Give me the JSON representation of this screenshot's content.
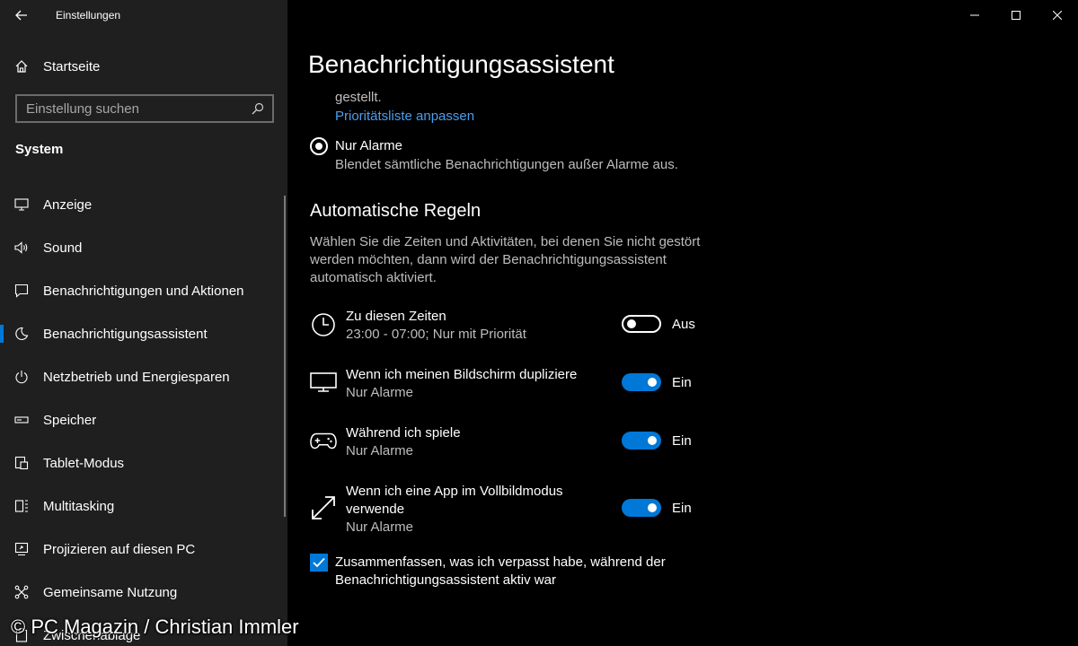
{
  "window": {
    "app_title": "Einstellungen"
  },
  "sidebar": {
    "home_label": "Startseite",
    "search_placeholder": "Einstellung suchen",
    "section_label": "System",
    "items": [
      {
        "label": "Anzeige",
        "icon": "monitor-icon"
      },
      {
        "label": "Sound",
        "icon": "speaker-icon"
      },
      {
        "label": "Benachrichtigungen und Aktionen",
        "icon": "message-icon"
      },
      {
        "label": "Benachrichtigungsassistent",
        "icon": "moon-icon",
        "active": true
      },
      {
        "label": "Netzbetrieb und Energiesparen",
        "icon": "power-icon"
      },
      {
        "label": "Speicher",
        "icon": "storage-icon"
      },
      {
        "label": "Tablet-Modus",
        "icon": "tablet-icon"
      },
      {
        "label": "Multitasking",
        "icon": "multitasking-icon"
      },
      {
        "label": "Projizieren auf diesen PC",
        "icon": "project-icon"
      },
      {
        "label": "Gemeinsame Nutzung",
        "icon": "share-icon"
      },
      {
        "label": "Zwischenablage",
        "icon": "clipboard-icon"
      }
    ]
  },
  "main": {
    "title": "Benachrichtigungsassistent",
    "cut_text": "gestellt.",
    "priority_link": "Prioritätsliste anpassen",
    "radio": {
      "label": "Nur Alarme",
      "description": "Blendet sämtliche Benachrichtigungen außer Alarme aus.",
      "selected": true
    },
    "rules_heading": "Automatische Regeln",
    "rules_description": "Wählen Sie die Zeiten und Aktivitäten, bei denen Sie nicht gestört werden möchten, dann wird der Benachrichtigungsassistent automatisch aktiviert.",
    "rules": [
      {
        "title": "Zu diesen Zeiten",
        "subtitle": "23:00 - 07:00; Nur mit Priorität",
        "state": "Aus",
        "on": false,
        "icon": "clock-icon"
      },
      {
        "title": "Wenn ich meinen Bildschirm dupliziere",
        "subtitle": "Nur Alarme",
        "state": "Ein",
        "on": true,
        "icon": "display-icon"
      },
      {
        "title": "Während ich spiele",
        "subtitle": "Nur Alarme",
        "state": "Ein",
        "on": true,
        "icon": "gamepad-icon"
      },
      {
        "title": "Wenn ich eine App im Vollbildmodus verwende",
        "subtitle": "Nur Alarme",
        "state": "Ein",
        "on": true,
        "icon": "fullscreen-icon"
      }
    ],
    "summary_checkbox": {
      "label": "Zusammenfassen, was ich verpasst habe, während der Benachrichtigungsassistent aktiv war",
      "checked": true
    }
  },
  "watermark": "© PC Magazin / Christian Immler",
  "colors": {
    "accent": "#0078d7",
    "link": "#4a9ef0",
    "sidebar_bg": "#1f1f1f",
    "main_bg": "#000000"
  }
}
